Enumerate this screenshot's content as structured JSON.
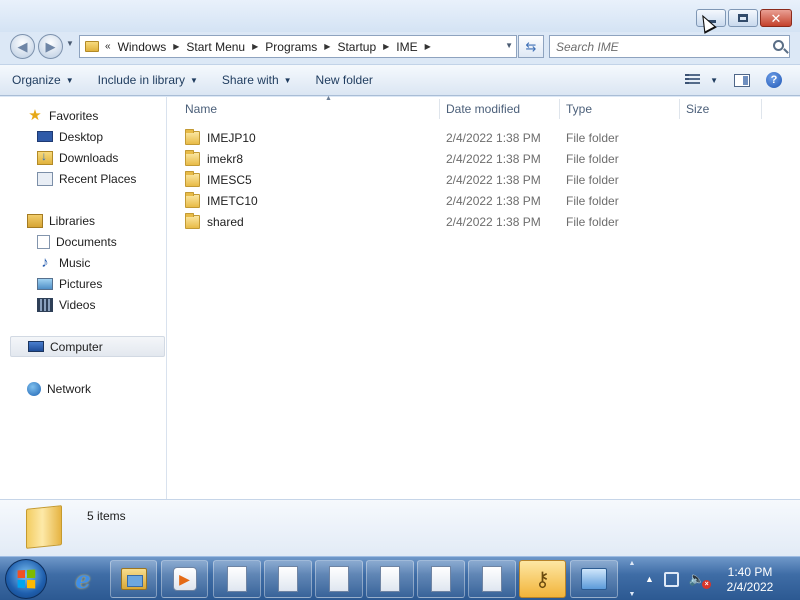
{
  "window": {
    "caption_buttons": [
      "minimize",
      "maximize",
      "close"
    ]
  },
  "address": {
    "overflow": "«",
    "crumbs": [
      "Windows",
      "Start Menu",
      "Programs",
      "Startup",
      "IME"
    ]
  },
  "search": {
    "placeholder": "Search IME"
  },
  "toolbar": {
    "organize": "Organize",
    "include_in_library": "Include in library",
    "share_with": "Share with",
    "new_folder": "New folder"
  },
  "navpane": {
    "favorites": {
      "label": "Favorites",
      "icon": "star-icon",
      "items": [
        {
          "label": "Desktop",
          "icon": "desktop-icon"
        },
        {
          "label": "Downloads",
          "icon": "downloads-icon"
        },
        {
          "label": "Recent Places",
          "icon": "recent-places-icon"
        }
      ]
    },
    "libraries": {
      "label": "Libraries",
      "icon": "libraries-icon",
      "items": [
        {
          "label": "Documents",
          "icon": "documents-icon"
        },
        {
          "label": "Music",
          "icon": "music-icon"
        },
        {
          "label": "Pictures",
          "icon": "pictures-icon"
        },
        {
          "label": "Videos",
          "icon": "videos-icon"
        }
      ]
    },
    "computer": {
      "label": "Computer",
      "icon": "computer-icon",
      "selected": true
    },
    "network": {
      "label": "Network",
      "icon": "network-icon"
    }
  },
  "columns": {
    "name": "Name",
    "date": "Date modified",
    "type": "Type",
    "size": "Size"
  },
  "files": [
    {
      "name": "IMEJP10",
      "date": "2/4/2022 1:38 PM",
      "type": "File folder",
      "size": ""
    },
    {
      "name": "imekr8",
      "date": "2/4/2022 1:38 PM",
      "type": "File folder",
      "size": ""
    },
    {
      "name": "IMESC5",
      "date": "2/4/2022 1:38 PM",
      "type": "File folder",
      "size": ""
    },
    {
      "name": "IMETC10",
      "date": "2/4/2022 1:38 PM",
      "type": "File folder",
      "size": ""
    },
    {
      "name": "shared",
      "date": "2/4/2022 1:38 PM",
      "type": "File folder",
      "size": ""
    }
  ],
  "details": {
    "item_count": "5 items"
  },
  "taskbar": {
    "buttons": [
      "internet-explorer-icon",
      "windows-explorer-icon",
      "media-player-icon",
      "document-icon",
      "document-icon",
      "document-icon",
      "document-icon",
      "document-icon",
      "document-icon",
      "keys-icon",
      "control-panel-icon"
    ],
    "active": "keys-icon",
    "time": "1:40 PM",
    "date": "2/4/2022"
  },
  "colors": {
    "accent": "#1e3b5e",
    "selection": "#e3e8ef",
    "taskbar": "#3f6da6",
    "active_task": "#f2b43a"
  }
}
